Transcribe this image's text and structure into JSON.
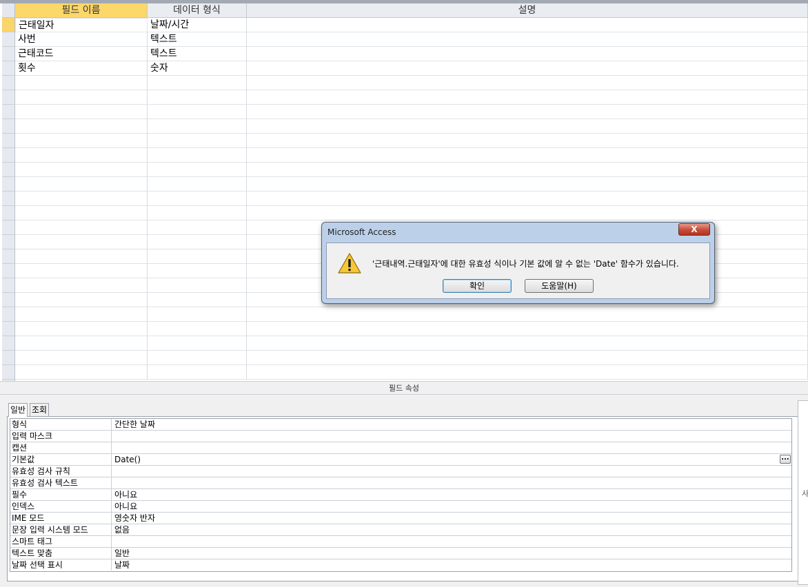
{
  "table_design": {
    "columns": [
      "필드 이름",
      "데이터 형식",
      "설명"
    ],
    "rows": [
      {
        "field_name": "근태일자",
        "data_type": "날짜/시간",
        "description": ""
      },
      {
        "field_name": "사번",
        "data_type": "텍스트",
        "description": ""
      },
      {
        "field_name": "근태코드",
        "data_type": "텍스트",
        "description": ""
      },
      {
        "field_name": "횟수",
        "data_type": "숫자",
        "description": ""
      }
    ]
  },
  "field_properties": {
    "header": "필드 속성",
    "tabs": [
      "일반",
      "조회"
    ],
    "active_tab": "일반",
    "rows": [
      {
        "label": "형식",
        "value": "간단한 날짜"
      },
      {
        "label": "입력 마스크",
        "value": ""
      },
      {
        "label": "캡션",
        "value": ""
      },
      {
        "label": "기본값",
        "value": "Date()"
      },
      {
        "label": "유효성 검사 규칙",
        "value": ""
      },
      {
        "label": "유효성 검사 텍스트",
        "value": ""
      },
      {
        "label": "필수",
        "value": "아니요"
      },
      {
        "label": "인덱스",
        "value": "아니요"
      },
      {
        "label": "IME 모드",
        "value": "영숫자 반자"
      },
      {
        "label": "문장 입력 시스템 모드",
        "value": "없음"
      },
      {
        "label": "스마트 태그",
        "value": ""
      },
      {
        "label": "텍스트 맞춤",
        "value": "일반"
      },
      {
        "label": "날짜 선택 표시",
        "value": "날짜"
      }
    ],
    "builder_label": "...",
    "side_text": "사"
  },
  "dialog": {
    "title": "Microsoft Access",
    "close_label": "X",
    "message": "'근태내역.근태일자'에 대한 유효성 식이나 기본 값에 알 수 없는 'Date' 함수가 있습니다.",
    "ok_label": "확인",
    "help_label": "도움말(H)"
  },
  "colors": {
    "active_header": "#fcd76a",
    "dialog_frame": "#bcd0ea",
    "close_button": "#c64b38"
  }
}
